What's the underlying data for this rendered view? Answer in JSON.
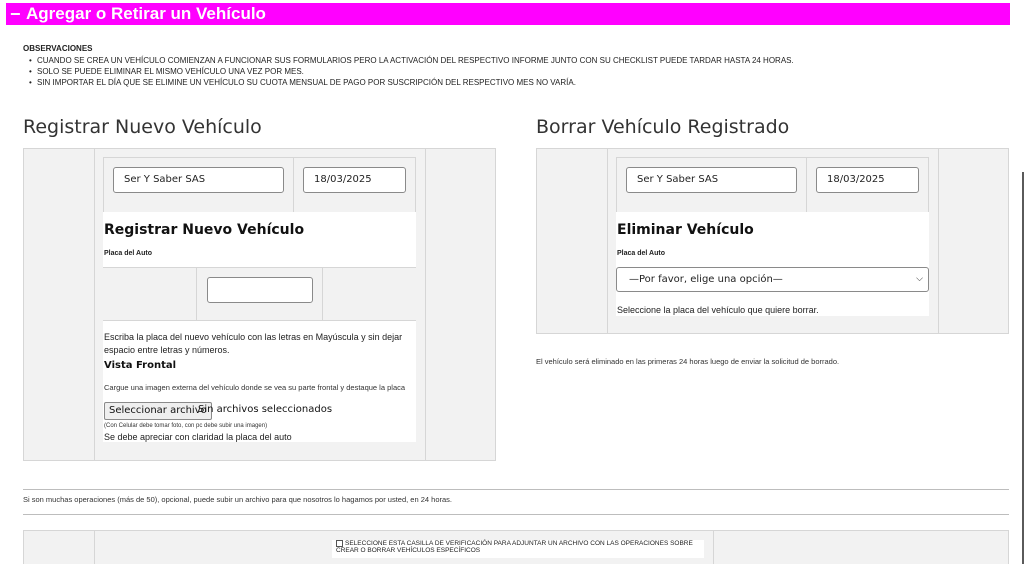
{
  "header": {
    "title": "Agregar o Retirar un Vehículo",
    "toggle": "−"
  },
  "observations": {
    "title": "OBSERVACIONES",
    "items": [
      "CUANDO SE CREA UN VEHÍCULO COMIENZAN A FUNCIONAR SUS FORMULARIOS PERO LA ACTIVACIÓN DEL RESPECTIVO INFORME JUNTO CON SU CHECKLIST PUEDE TARDAR HASTA 24 HORAS.",
      "SOLO SE PUEDE ELIMINAR EL MISMO VEHÍCULO UNA VEZ POR MES.",
      "SIN IMPORTAR EL DÍA QUE SE ELIMINE UN VEHÍCULO SU CUOTA MENSUAL DE PAGO POR SUSCRIPCIÓN DEL RESPECTIVO MES NO VARÍA."
    ]
  },
  "register": {
    "section_title": "Registrar Nuevo Vehículo",
    "company": "Ser Y Saber SAS",
    "date": "18/03/2025",
    "form_title": "Registrar Nuevo Vehículo",
    "plate_label": "Placa del Auto",
    "plate_value": "",
    "plate_help": "Escriba la placa del nuevo vehículo con las letras en Mayúscula y sin dejar espacio entre letras y números.",
    "front_title": "Vista Frontal",
    "front_help": "Cargue una imagen externa del vehículo donde se vea su parte frontal y destaque la placa",
    "file_button": "Seleccionar archivo",
    "file_status": "Sin archivos seleccionados",
    "phone_note": "(Con Celular debe tomar foto, con pc debe subir una imagen)",
    "clarity_note": "Se debe apreciar con claridad la placa del auto"
  },
  "delete": {
    "section_title": "Borrar Vehículo Registrado",
    "company": "Ser Y Saber SAS",
    "date": "18/03/2025",
    "form_title": "Eliminar Vehículo",
    "plate_label": "Placa del Auto",
    "select_value": "—Por favor, elige una opción—",
    "select_help": "Seleccione la placa del vehículo que quiere borrar.",
    "removal_note": "El vehículo será eliminado en las primeras 24 horas luego de enviar la solicitud de borrado."
  },
  "bulk": {
    "note": "Si son muchas operaciones (más de 50), opcional, puede subir un archivo para que nosotros lo hagamos por usted, en 24 horas.",
    "checkbox_label": "SELECCIONE ESTA CASILLA DE VERIFICACIÓN PARA ADJUNTAR UN ARCHIVO CON LAS OPERACIONES SOBRE CREAR O BORRAR VEHÍCULOS ESPECÍFICOS"
  }
}
